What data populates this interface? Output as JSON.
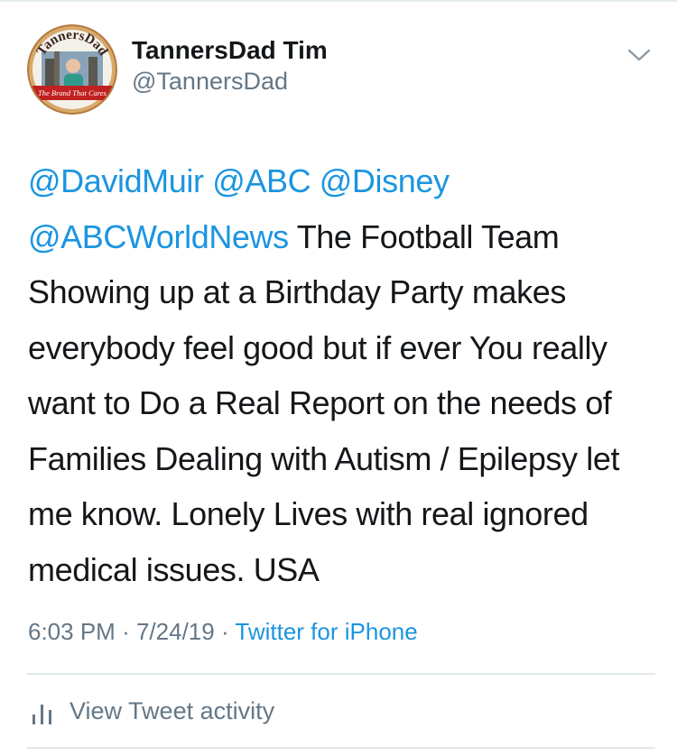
{
  "tweet": {
    "author": {
      "name": "TannersDad Tim",
      "handle": "@TannersDad",
      "avatar_text": "TannersDad",
      "avatar_banner": "The Brand That Cares"
    },
    "mentions": [
      "@DavidMuir",
      "@ABC",
      "@Disney",
      "@ABCWorldNews"
    ],
    "text": "The Football Team Showing up at a Birthday Party makes everybody feel good but if ever You really want to Do a Real Report on the needs of Families Dealing with Autism / Epilepsy let me know. Lonely Lives with real ignored medical issues. USA",
    "time": "6:03 PM",
    "date": "7/24/19",
    "source": "Twitter for iPhone",
    "separator": "·"
  },
  "actions": {
    "activity_label": "View Tweet activity",
    "menu_icon": "chevron-down-icon",
    "activity_icon": "bar-chart-icon"
  },
  "colors": {
    "link": "#1b95e0",
    "secondary": "#657786",
    "text": "#14171a",
    "divider": "#e1e8ed"
  }
}
